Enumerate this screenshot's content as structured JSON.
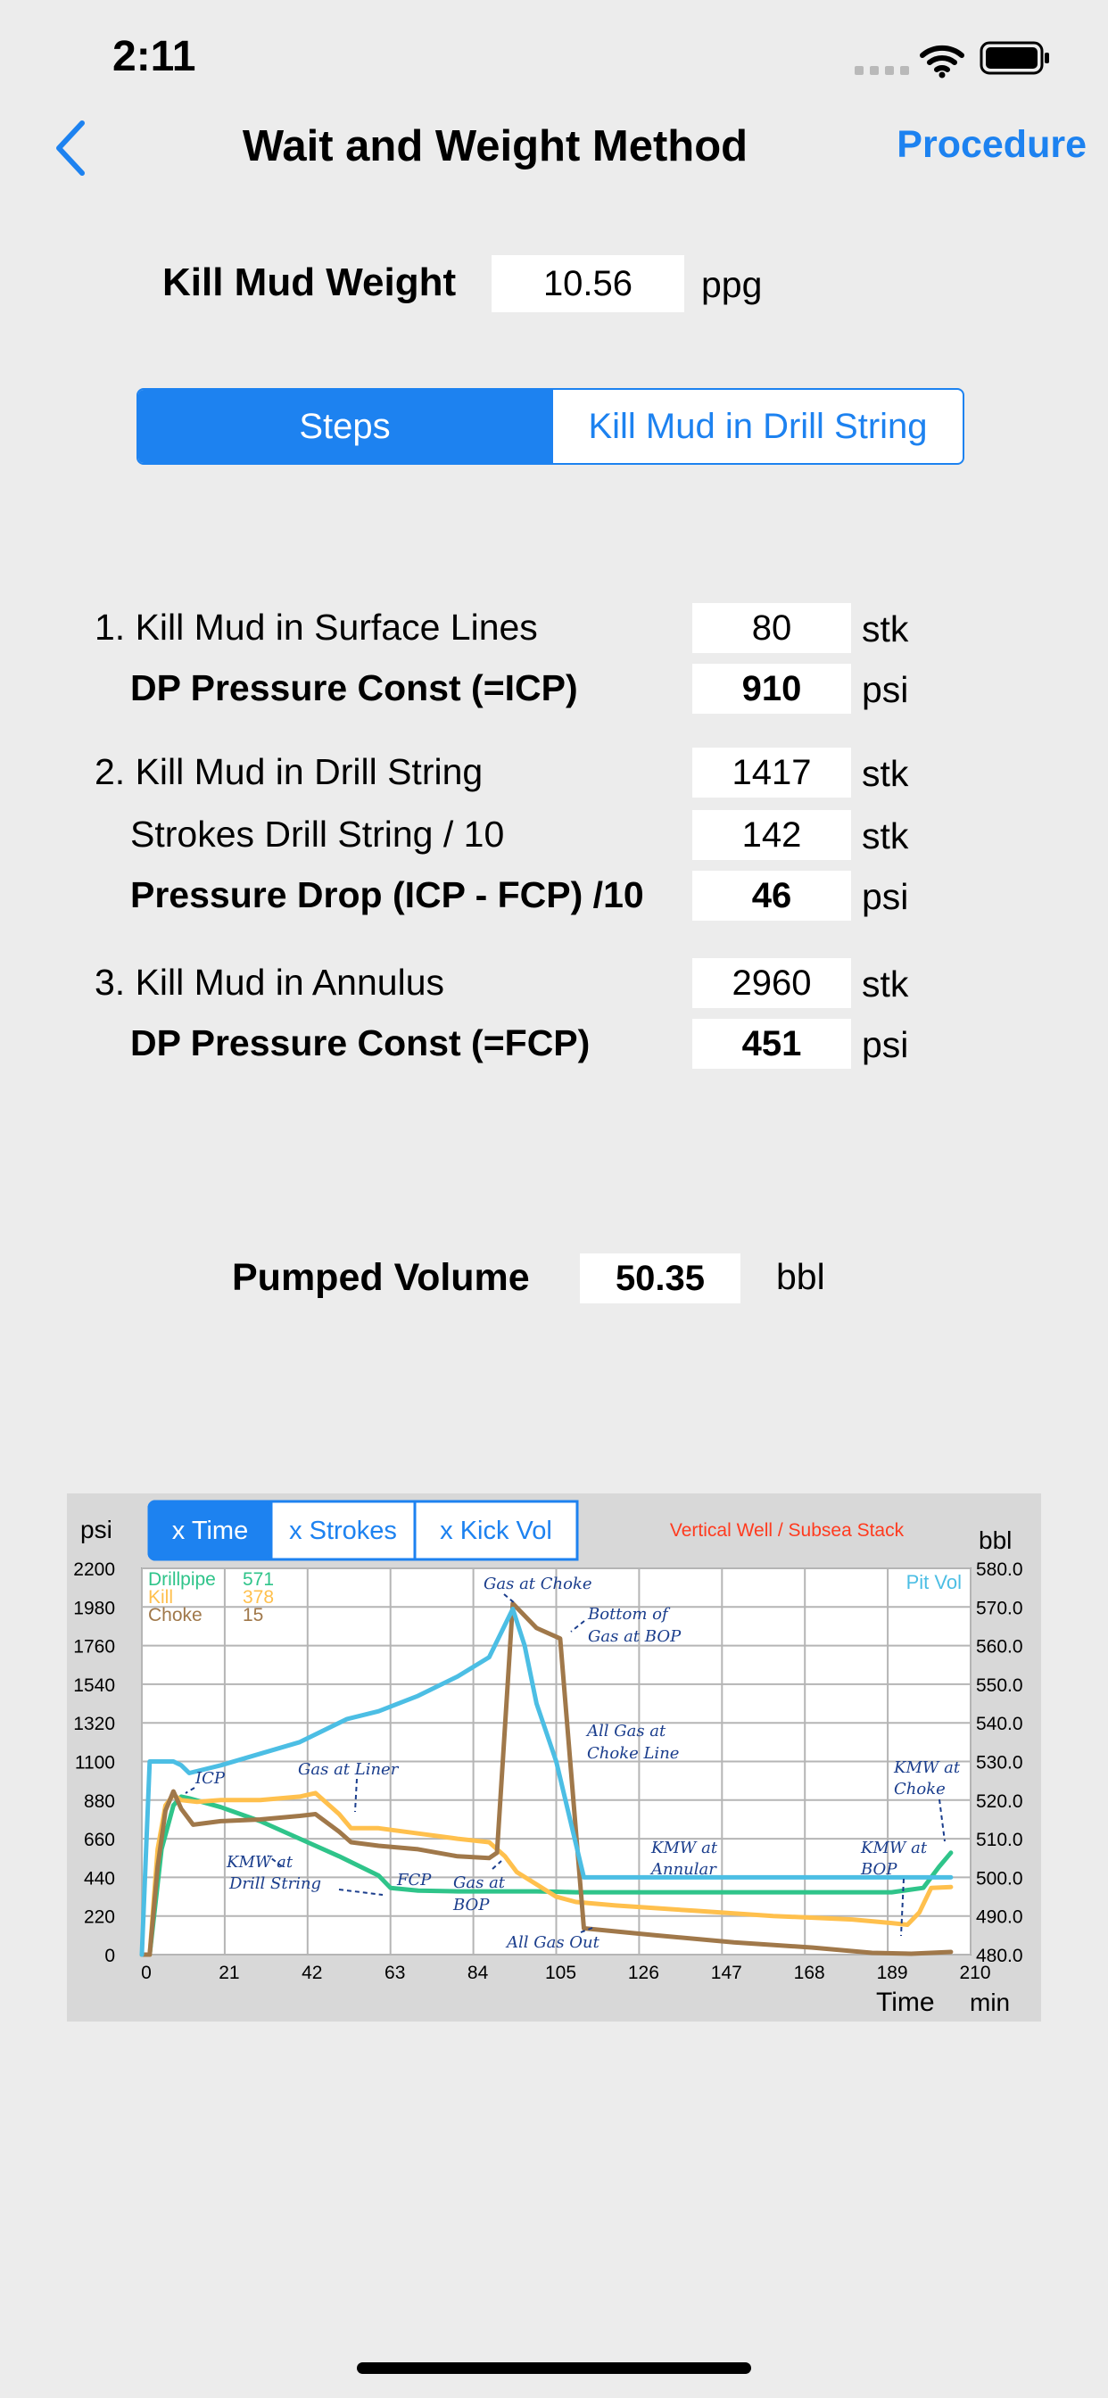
{
  "status_bar": {
    "time": "2:11",
    "wifi_icon": "wifi-icon",
    "battery_icon": "battery-icon"
  },
  "nav": {
    "back_icon": "chevron-left-icon",
    "title": "Wait and Weight Method",
    "procedure": "Procedure"
  },
  "kill_mud_weight": {
    "label": "Kill Mud Weight",
    "value": "10.56",
    "unit": "ppg"
  },
  "segmented": {
    "selected": "Steps",
    "other": "Kill Mud in Drill String"
  },
  "steps": [
    {
      "label": "1. Kill Mud in Surface Lines",
      "value": "80",
      "unit": "stk",
      "bold": false,
      "indent": false
    },
    {
      "label": "DP Pressure Const (=ICP)",
      "value": "910",
      "unit": "psi",
      "bold": true,
      "indent": true
    },
    {
      "label": "2. Kill Mud in Drill String",
      "value": "1417",
      "unit": "stk",
      "bold": false,
      "indent": false
    },
    {
      "label": "Strokes Drill String / 10",
      "value": "142",
      "unit": "stk",
      "bold": false,
      "indent": true
    },
    {
      "label": "Pressure Drop (ICP - FCP) /10",
      "value": "46",
      "unit": "psi",
      "bold": true,
      "indent": true
    },
    {
      "label": "3. Kill Mud in Annulus",
      "value": "2960",
      "unit": "stk",
      "bold": false,
      "indent": false
    },
    {
      "label": "DP Pressure Const (=FCP)",
      "value": "451",
      "unit": "psi",
      "bold": true,
      "indent": true
    }
  ],
  "pumped_volume": {
    "label": "Pumped Volume",
    "value": "50.35",
    "unit": "bbl"
  },
  "chart_panel": {
    "buttons": [
      "x Time",
      "x Strokes",
      "x Kick Vol"
    ],
    "selected_button": "x Time",
    "stack_label": "Vertical Well / Subsea Stack",
    "stack_color": "#ff3b1f",
    "left_unit": "psi",
    "right_unit": "bbl",
    "x_unit": "min",
    "xlabel": "Time"
  },
  "chart_data": {
    "type": "line",
    "title": "",
    "xlabel": "Time",
    "ylabel": "psi",
    "y2label": "bbl",
    "x_ticks": [
      "0",
      "21",
      "42",
      "63",
      "84",
      "105",
      "126",
      "147",
      "168",
      "189",
      "210"
    ],
    "y_ticks": [
      "0",
      "220",
      "440",
      "660",
      "880",
      "1100",
      "1320",
      "1540",
      "1760",
      "1980",
      "2200"
    ],
    "y2_ticks": [
      "480.0",
      "490.0",
      "500.0",
      "510.0",
      "520.0",
      "530.0",
      "540.0",
      "550.0",
      "560.0",
      "570.0",
      "580.0"
    ],
    "xlim": [
      0,
      210
    ],
    "ylim": [
      0,
      2200
    ],
    "y2lim": [
      480,
      580
    ],
    "grid": true,
    "legend": [
      {
        "name": "Drillpipe",
        "value": "571",
        "color": "#2fc48a"
      },
      {
        "name": "Kill",
        "value": "378",
        "color": "#ffc04d"
      },
      {
        "name": "Choke",
        "value": "15",
        "color": "#a0784a"
      }
    ],
    "pit_vol_label": "Pit Vol",
    "series": [
      {
        "name": "Drillpipe",
        "color": "#2fc48a",
        "axis": "left",
        "x": [
          0,
          2,
          5,
          8,
          10,
          12,
          20,
          30,
          40,
          50,
          60,
          63,
          70,
          80,
          90,
          100,
          105,
          110,
          115,
          130,
          150,
          170,
          190,
          198,
          202,
          205
        ],
        "y": [
          0,
          0,
          600,
          850,
          900,
          890,
          840,
          760,
          660,
          560,
          450,
          380,
          365,
          360,
          360,
          360,
          358,
          355,
          355,
          355,
          355,
          355,
          355,
          380,
          500,
          580
        ]
      },
      {
        "name": "Kill",
        "color": "#ffc04d",
        "axis": "left",
        "x": [
          0,
          2,
          4,
          6,
          8,
          10,
          14,
          20,
          30,
          40,
          44,
          50,
          53,
          60,
          70,
          80,
          88,
          92,
          95,
          100,
          105,
          110,
          120,
          140,
          160,
          180,
          190,
          194,
          197,
          200,
          205
        ],
        "y": [
          0,
          0,
          600,
          850,
          910,
          880,
          870,
          880,
          880,
          900,
          920,
          800,
          720,
          720,
          690,
          660,
          640,
          560,
          470,
          400,
          330,
          300,
          280,
          250,
          220,
          200,
          180,
          170,
          240,
          380,
          385
        ]
      },
      {
        "name": "Choke",
        "color": "#a0784a",
        "axis": "left",
        "x": [
          0,
          2,
          4,
          6,
          8,
          10,
          13,
          20,
          30,
          40,
          44,
          50,
          53,
          60,
          70,
          80,
          88,
          90,
          94,
          100,
          106,
          112,
          130,
          150,
          170,
          185,
          195,
          205
        ],
        "y": [
          0,
          0,
          500,
          820,
          930,
          830,
          740,
          760,
          770,
          790,
          800,
          700,
          640,
          620,
          600,
          560,
          550,
          580,
          2000,
          1860,
          1800,
          150,
          110,
          70,
          40,
          10,
          5,
          15
        ]
      },
      {
        "name": "Pit Vol",
        "color": "#4cbee4",
        "axis": "right",
        "x": [
          0,
          2,
          8,
          10,
          12,
          20,
          30,
          40,
          52,
          60,
          70,
          80,
          88,
          94,
          97,
          100,
          105,
          112,
          130,
          150,
          170,
          190,
          198,
          205
        ],
        "y": [
          480,
          530,
          530,
          529,
          527,
          529,
          532,
          535,
          541,
          543,
          547,
          552,
          557,
          569.5,
          560,
          545,
          530,
          500,
          500,
          500,
          500,
          500,
          500,
          500
        ]
      }
    ],
    "annotations": [
      {
        "text": "Gas at Choke"
      },
      {
        "text": "Bottom of"
      },
      {
        "text": "Gas at BOP"
      },
      {
        "text": "All Gas at"
      },
      {
        "text": "Choke Line"
      },
      {
        "text": "ICP"
      },
      {
        "text": "Gas at Liner"
      },
      {
        "text": "KMW at"
      },
      {
        "text": "Choke"
      },
      {
        "text": "KMW at"
      },
      {
        "text": "Drill String"
      },
      {
        "text": "FCP"
      },
      {
        "text": "Gas at"
      },
      {
        "text": "BOP"
      },
      {
        "text": "KMW at"
      },
      {
        "text": "Annular"
      },
      {
        "text": "KMW at"
      },
      {
        "text": "BOP"
      },
      {
        "text": "All Gas Out"
      }
    ]
  }
}
